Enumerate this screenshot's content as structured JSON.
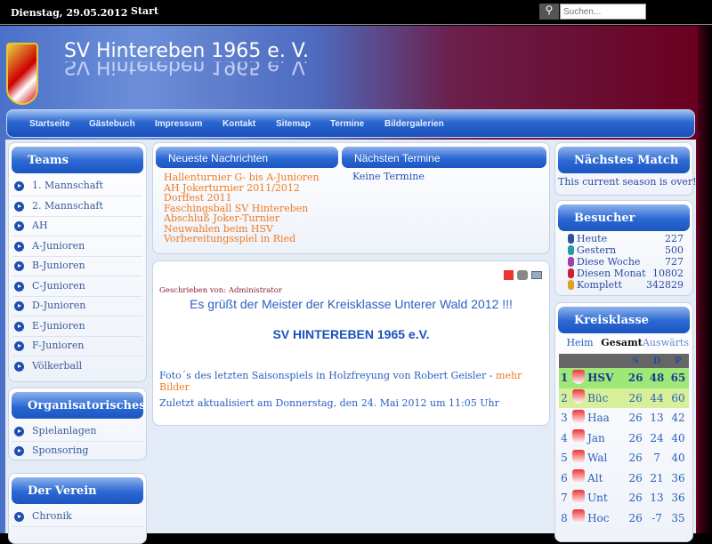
{
  "topbar": {
    "date": "Dienstag, 29.05.2012",
    "start": "Start",
    "search_placeholder": "Suchen..."
  },
  "site": {
    "title": "SV Hintereben 1965 e. V.",
    "logo_text": "SV HINTEREBEN 1965"
  },
  "nav": [
    "Startseite",
    "Gästebuch",
    "Impressum",
    "Kontakt",
    "Sitemap",
    "Termine",
    "Bildergalerien"
  ],
  "teams": {
    "title": "Teams",
    "items": [
      "1. Mannschaft",
      "2. Mannschaft",
      "AH",
      "A-Junioren",
      "B-Junioren",
      "C-Junioren",
      "D-Junioren",
      "E-Junioren",
      "F-Junioren",
      "Völkerball"
    ]
  },
  "org": {
    "title": "Organisatorisches",
    "items": [
      "Spielanlagen",
      "Sponsoring"
    ]
  },
  "verein": {
    "title": "Der Verein",
    "items": [
      "Chronik"
    ]
  },
  "news": {
    "title": "Neueste Nachrichten",
    "items": [
      "Hallenturnier G- bis A-Junioren",
      "AH Jokerturnier 2011/2012",
      "Dorffest 2011",
      "Faschingsball SV Hintereben",
      "Abschluß Joker-Turnier",
      "Neuwahlen beim HSV",
      "Vorbereitungsspiel in Ried"
    ]
  },
  "termine": {
    "title": "Nächsten Termine",
    "text": "Keine Termine"
  },
  "article": {
    "author": "Geschrieben von: Administrator",
    "headline": "Es grüßt der Meister der Kreisklasse Unterer Wald 2012 !!!",
    "club": "SV HINTEREBEN 1965 e.V.",
    "photo_text": "Foto´s des letzten Saisonspiels in Holzfreyung von Robert Geisler - ",
    "photo_link": "mehr Bilder",
    "updated": "Zuletzt aktualisiert am Donnerstag, den 24. Mai 2012 um 11:05 Uhr",
    "icons": [
      "pdf-icon",
      "print-icon",
      "email-icon"
    ]
  },
  "match": {
    "title": "Nächstes Match",
    "text": "This current season is over!"
  },
  "visitors": {
    "title": "Besucher",
    "rows": [
      {
        "label": "Heute",
        "value": "227",
        "color": "#3050a0"
      },
      {
        "label": "Gestern",
        "value": "500",
        "color": "#20a0a0"
      },
      {
        "label": "Diese Woche",
        "value": "727",
        "color": "#a040b0"
      },
      {
        "label": "Diesen Monat",
        "value": "10802",
        "color": "#d02030"
      },
      {
        "label": "Komplett",
        "value": "342829",
        "color": "#e0a020"
      }
    ]
  },
  "league": {
    "title": "Kreisklasse",
    "tabs": [
      "Heim",
      "Gesamt",
      "Auswärts"
    ],
    "active_tab": "Gesamt",
    "cols": [
      "S",
      "D",
      "P"
    ],
    "rows": [
      [
        "1",
        "HSV",
        "26",
        "48",
        "65"
      ],
      [
        "2",
        "Büc",
        "26",
        "44",
        "60"
      ],
      [
        "3",
        "Haa",
        "26",
        "13",
        "42"
      ],
      [
        "4",
        "Jan",
        "26",
        "24",
        "40"
      ],
      [
        "5",
        "Wal",
        "26",
        "7",
        "40"
      ],
      [
        "6",
        "Alt",
        "26",
        "21",
        "36"
      ],
      [
        "7",
        "Unt",
        "26",
        "13",
        "36"
      ],
      [
        "8",
        "Hoc",
        "26",
        "-7",
        "35"
      ]
    ]
  }
}
